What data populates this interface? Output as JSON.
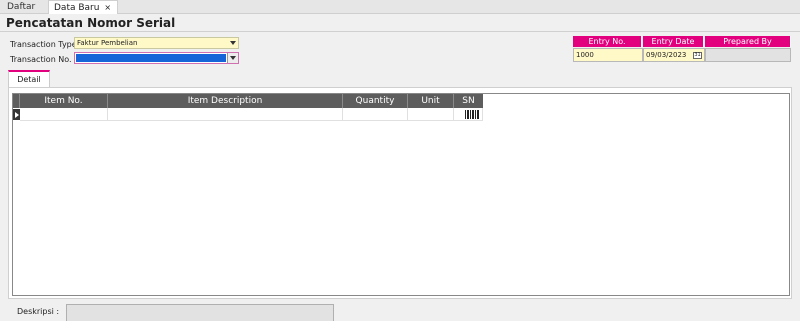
{
  "tabs": [
    {
      "label": "Daftar",
      "active": false
    },
    {
      "label": "Data Baru",
      "active": true,
      "close": "×"
    }
  ],
  "page": {
    "title": "Pencatatan Nomor Serial"
  },
  "form": {
    "transaction_type_label": "Transaction Type",
    "transaction_type_value": "Faktur Pembelian",
    "transaction_no_label": "Transaction No.",
    "transaction_no_value": ""
  },
  "info_table": {
    "headers": [
      "Entry No.",
      "Entry Date",
      "Prepared By"
    ],
    "values": {
      "entry_no": "1000",
      "entry_date": "09/03/2023",
      "prepared_by": ""
    },
    "calendar_glyph": "31"
  },
  "detail_tab": {
    "label": "Detail"
  },
  "grid": {
    "columns": [
      "Item No.",
      "Item Description",
      "Quantity",
      "Unit",
      "SN"
    ],
    "rows": [
      {
        "item_no": "",
        "item_description": "",
        "quantity": "",
        "unit": "",
        "sn": "barcode-icon"
      }
    ]
  },
  "footer": {
    "description_label": "Deskripsi :",
    "description_value": ""
  },
  "colors": {
    "accent": "#e3007f",
    "selected": "#1565d8",
    "required_field": "#fff9c8",
    "grid_header": "#5d5d5d"
  }
}
